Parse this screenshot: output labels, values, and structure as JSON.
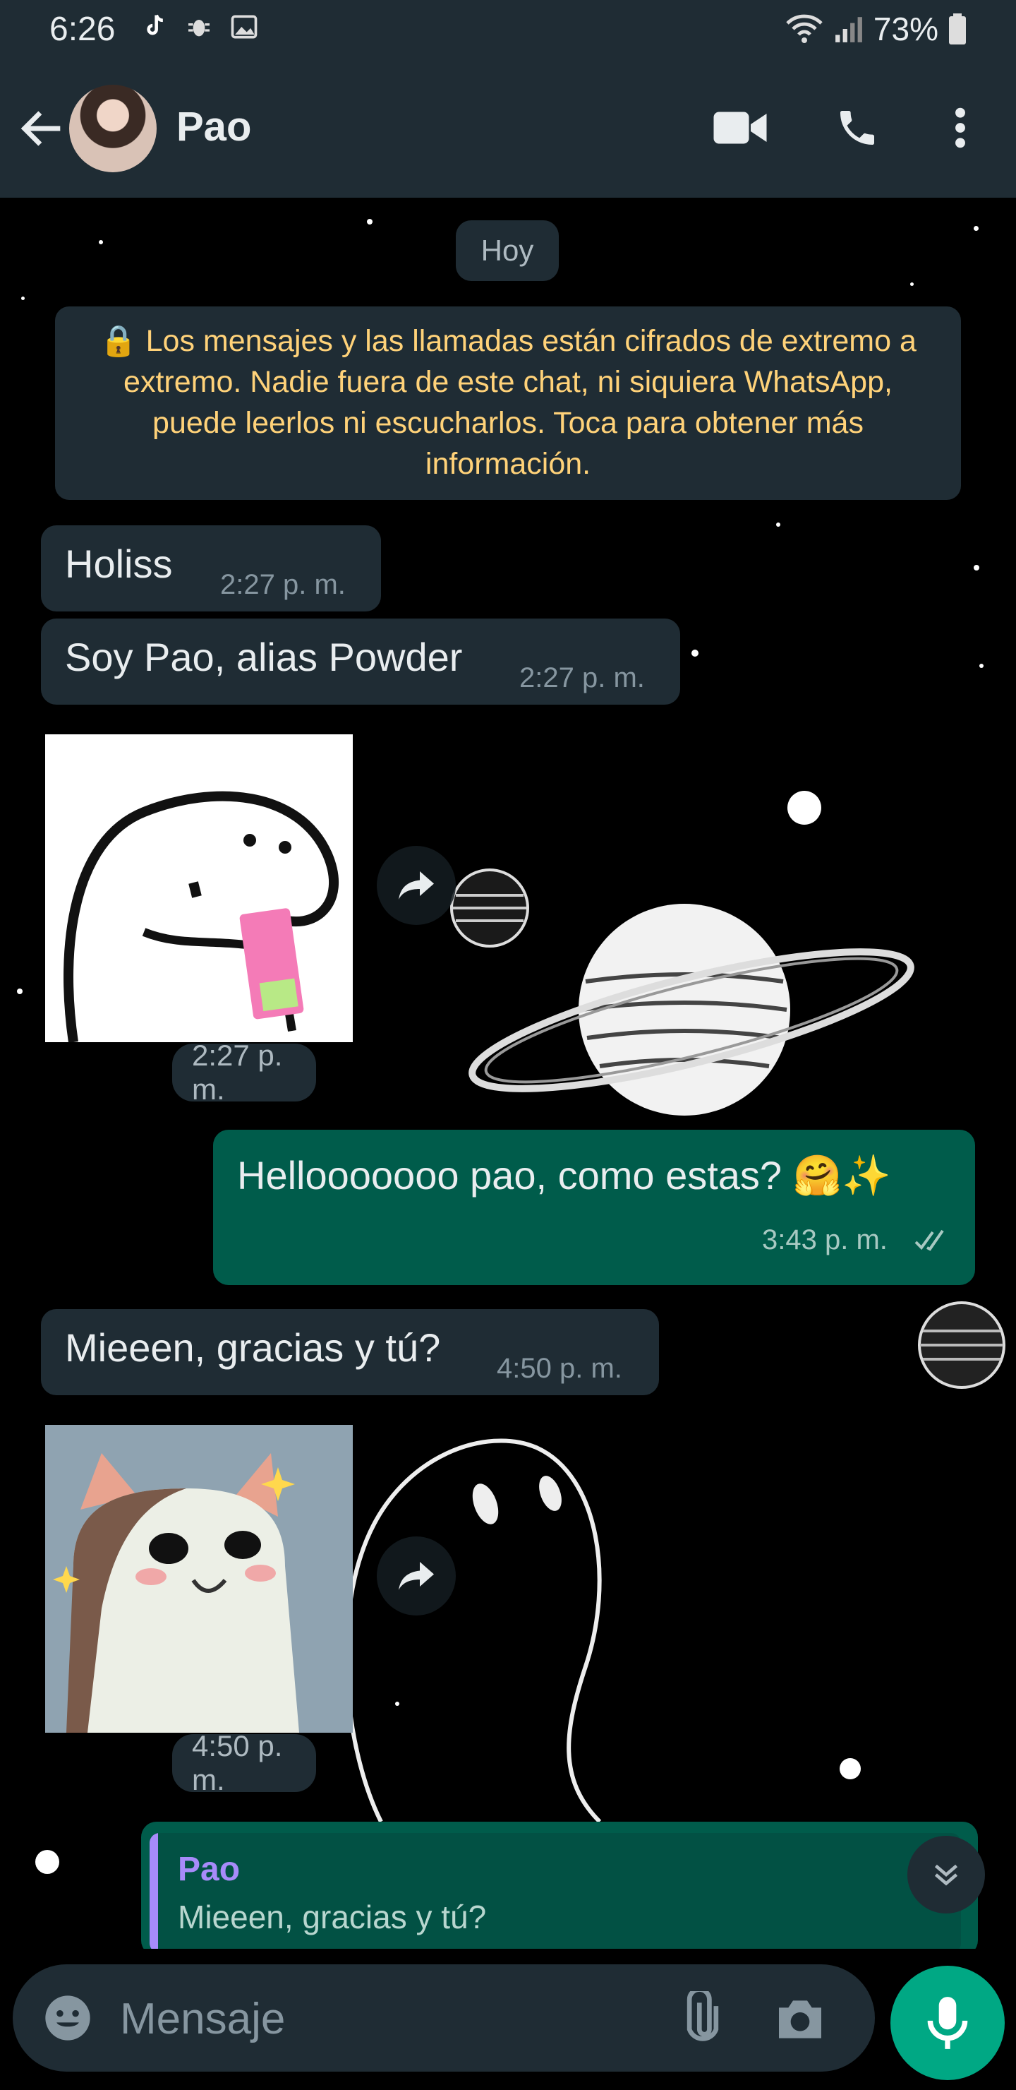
{
  "status_bar": {
    "time": "6:26",
    "battery": "73%"
  },
  "header": {
    "contact_name": "Pao"
  },
  "chat": {
    "date_chip": "Hoy",
    "encryption_notice": "🔒 Los mensajes y las llamadas están cifrados de extremo a extremo. Nadie fuera de este chat, ni siquiera WhatsApp, puede leerlos ni escucharlos. Toca para obtener más información.",
    "messages": [
      {
        "direction": "incoming",
        "text": "Holiss",
        "time": "2:27 p. m."
      },
      {
        "direction": "incoming",
        "text": "Soy Pao, alias Powder",
        "time": "2:27 p. m."
      },
      {
        "direction": "incoming",
        "type": "sticker",
        "sticker": "flork-drinking-juice-box",
        "time": "2:27 p. m."
      },
      {
        "direction": "outgoing",
        "text": "Hellooooooo pao, como estas? 🤗✨",
        "time": "3:43 p. m.",
        "status": "read"
      },
      {
        "direction": "incoming",
        "text": "Mieeen, gracias y tú?",
        "time": "4:50 p. m."
      },
      {
        "direction": "incoming",
        "type": "sticker",
        "sticker": "pixel-pop-cat",
        "time": "4:50 p. m."
      }
    ],
    "reply_preview": {
      "name": "Pao",
      "text": "Mieeen, gracias y tú?"
    }
  },
  "composer": {
    "placeholder": "Mensaje"
  },
  "colors": {
    "header_bg": "#1f2c34",
    "incoming_bubble": "#1f2c34",
    "outgoing_bubble": "#005c4b",
    "accent": "#00a884",
    "encryption_text": "#ffd279",
    "reply_name": "#a78bfa"
  },
  "icons": [
    "back-arrow-icon",
    "video-call-icon",
    "voice-call-icon",
    "more-options-icon",
    "forward-icon",
    "scroll-down-icon",
    "emoji-icon",
    "attach-icon",
    "camera-icon",
    "mic-icon",
    "double-check-icon"
  ]
}
